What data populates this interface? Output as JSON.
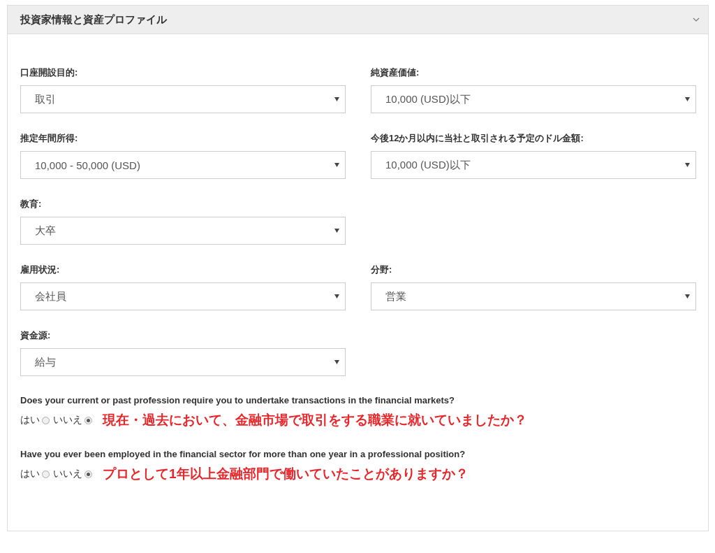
{
  "panel": {
    "title": "投資家情報と資産プロファイル",
    "expanded": true
  },
  "sections": [
    {
      "rows": [
        [
          {
            "label": "口座開設目的:",
            "value": "取引"
          },
          {
            "label": "純資産価値:",
            "value": "10,000 (USD)以下"
          }
        ],
        [
          {
            "label": "推定年間所得:",
            "value": "10,000 - 50,000 (USD)"
          },
          {
            "label": "今後12か月以内に当社と取引される予定のドル金額:",
            "value": "10,000 (USD)以下"
          }
        ],
        [
          {
            "label": "教育:",
            "value": "大卒"
          }
        ],
        [
          {
            "label": "雇用状況:",
            "value": "会社員"
          },
          {
            "label": "分野:",
            "value": "営業"
          }
        ]
      ]
    },
    {
      "rows": [
        [
          {
            "label": "資金源:",
            "value": "給与"
          }
        ]
      ]
    }
  ],
  "questions": [
    {
      "text": "Does your current or past profession require you to undertake transactions in the financial markets?",
      "options": [
        {
          "label": "はい",
          "selected": false
        },
        {
          "label": "いいえ",
          "selected": true
        }
      ],
      "annotation": "現在・過去において、金融市場で取引をする職業に就いていましたか？"
    },
    {
      "text": "Have you ever been employed in the financial sector for more than one year in a professional position?",
      "options": [
        {
          "label": "はい",
          "selected": false
        },
        {
          "label": "いいえ",
          "selected": true
        }
      ],
      "annotation": "プロとして1年以上金融部門で働いていたことがありますか？"
    }
  ]
}
